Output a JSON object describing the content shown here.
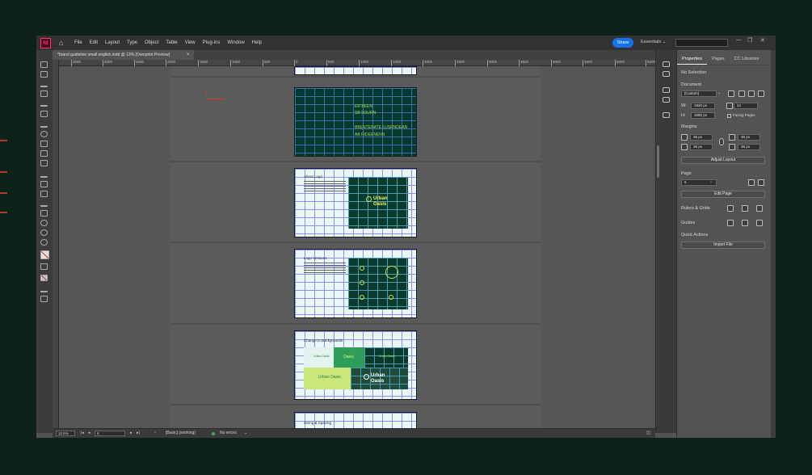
{
  "app": {
    "logo": "Id",
    "accent": "#ff3366"
  },
  "menu": [
    "File",
    "Edit",
    "Layout",
    "Type",
    "Object",
    "Table",
    "View",
    "Plug-ins",
    "Window",
    "Help"
  ],
  "share_label": "Share",
  "workspace_label": "Essentials",
  "window_buttons": {
    "minimize": "—",
    "restore": "❐",
    "close": "✕"
  },
  "document_tab": {
    "title": "*brand guideline small english.indd @ 13% [Overprint Preview]",
    "close": "×"
  },
  "ruler_ticks": [
    "3500",
    "3000",
    "2500",
    "2000",
    "1500",
    "1000",
    "500",
    "0",
    "500",
    "1000",
    "1500",
    "2000",
    "2500",
    "3000",
    "3500",
    "4000",
    "4500",
    "5000",
    "5500"
  ],
  "pages": {
    "p2": {
      "brand_lines": [
        "ER BEEN",
        "SB SOURN",
        "BBENTENATE LUSRNDEAN",
        "AB RIDEENENN"
      ]
    },
    "p3": {
      "title": "About Logo",
      "brand": [
        "Urban",
        "Oasis"
      ]
    },
    "p4": {
      "title": "Logo Versions"
    },
    "p5": {
      "title": "Change to Backgrounds",
      "brand": [
        "Urban",
        "Oasis"
      ],
      "small_marks": [
        "Urban Oasis",
        "Oasis",
        "Urban Oasis",
        "Urban Oasis"
      ]
    },
    "p6": {
      "title": "Sizing & Spacing"
    }
  },
  "panel": {
    "tabs": [
      "Properties",
      "Pages",
      "CC Libraries"
    ],
    "selection": "No Selection",
    "document_label": "Document",
    "preset": "[Custom]",
    "width_label": "W:",
    "width": "1920 px",
    "height_label": "H:",
    "height": "1080 px",
    "pages_count": "24",
    "facing_pages": "Facing Pages",
    "margins_label": "Margins",
    "margin_top": "36 px",
    "margin_bottom": "36 px",
    "margin_left": "36 px",
    "margin_right": "36 px",
    "adjust_layout": "Adjust Layout",
    "page_label": "Page",
    "page_value": "6",
    "edit_page": "Edit Page",
    "rulers_grids": "Rulers & Grids",
    "guides": "Guides",
    "quick_actions": "Quick Actions",
    "import_file": "Import File"
  },
  "status": {
    "zoom": "12.5%",
    "page": "6",
    "style": "[Basic] (working)",
    "preflight": "No errors",
    "preflight_color": "#3fb04a"
  }
}
